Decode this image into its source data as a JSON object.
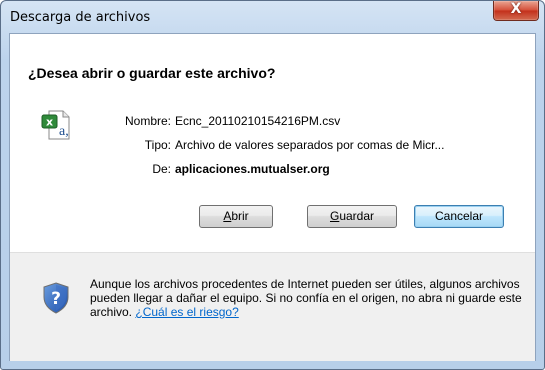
{
  "window": {
    "title": "Descarga de archivos",
    "close_glyph": "X"
  },
  "dialog": {
    "question": "¿Desea abrir o guardar este archivo?",
    "file_icon": "excel-csv-file-icon",
    "fields": {
      "name_label": "Nombre:",
      "name_value": "Ecnc_20110210154216PM.csv",
      "type_label": "Tipo:",
      "type_value": "Archivo de valores separados por comas de Micr...",
      "from_label": "De:",
      "from_value": "aplicaciones.mutualser.org"
    },
    "buttons": {
      "open_access": "A",
      "open_rest": "brir",
      "save_access": "G",
      "save_rest": "uardar",
      "cancel": "Cancelar"
    }
  },
  "warning": {
    "icon": "shield-question-icon",
    "text": "Aunque los archivos procedentes de Internet pueden ser útiles, algunos archivos pueden llegar a dañar el equipo. Si no confía en el origen, no abra ni guarde este archivo.",
    "link": "¿Cuál es el riesgo?"
  },
  "colors": {
    "link": "#0066cc",
    "default_button_border": "#3c7fb1"
  }
}
